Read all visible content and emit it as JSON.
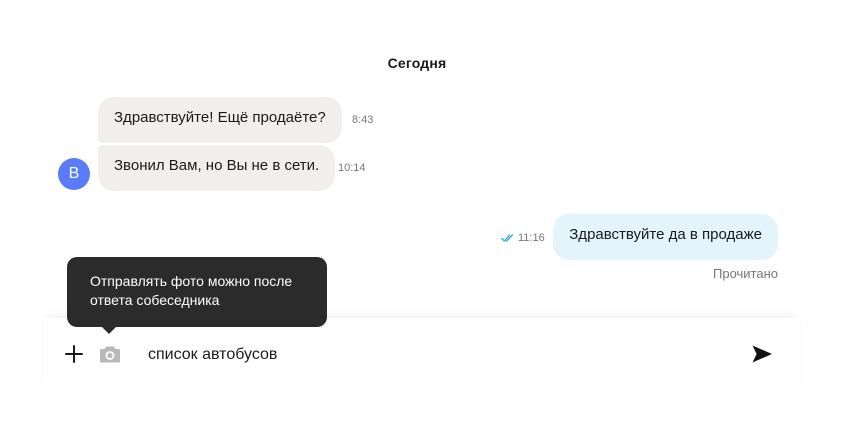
{
  "date_separator": "Сегодня",
  "contact": {
    "avatar_letter": "В",
    "avatar_color": "#5b7cf7"
  },
  "messages": [
    {
      "direction": "incoming",
      "text": "Здравствуйте! Ещё продаёте?",
      "time": "8:43"
    },
    {
      "direction": "incoming",
      "text": "Звонил Вам, но Вы не в сети.",
      "time": "10:14"
    },
    {
      "direction": "outgoing",
      "text": "Здравствуйте да в продаже",
      "time": "11:16",
      "status_icon": "double-check-icon"
    }
  ],
  "read_status": "Прочитано",
  "tooltip": {
    "text": "Отправлять фото можно после ответа собеседника"
  },
  "composer": {
    "input_value": "список автобусов",
    "icons": [
      "plus-icon",
      "camera-icon",
      "send-icon"
    ]
  },
  "colors": {
    "incoming_bubble": "#f0efed",
    "outgoing_bubble": "#e4f4fd",
    "read_check": "#2aa3e6",
    "tooltip_bg": "#2b2b2b"
  }
}
